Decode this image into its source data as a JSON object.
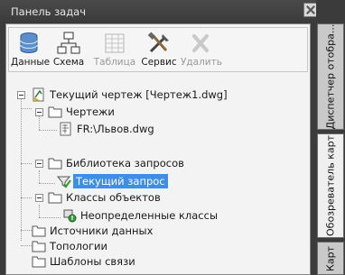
{
  "title": "Панель задач",
  "toolbar": {
    "data": "Данные",
    "schema": "Схема",
    "table": "Таблица",
    "service": "Сервис",
    "delete": "Удалить"
  },
  "tree": {
    "root": "Текущий чертеж [Чертеж1.dwg]",
    "drawings": "Чертежи",
    "drawing_file": "FR:\\Львов.dwg",
    "query_library": "Библиотека запросов",
    "current_query": "Текущий запрос",
    "object_classes": "Классы объектов",
    "undefined_classes": "Неопределенные классы",
    "data_sources": "Источники данных",
    "topologies": "Топологии",
    "link_templates": "Шаблоны связи"
  },
  "side_tabs": {
    "map_manager": "Диспетчер отобра...",
    "map_explorer": "Обозреватель карт",
    "map": "Карт"
  },
  "colors": {
    "selection": "#3d8ee6"
  }
}
